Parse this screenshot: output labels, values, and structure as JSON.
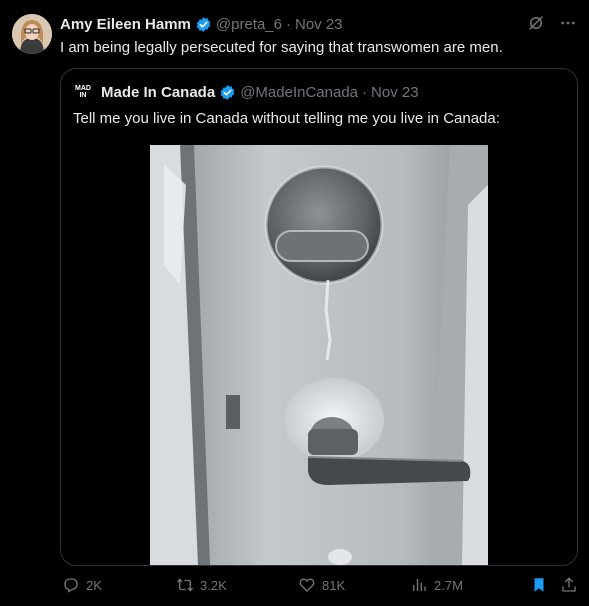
{
  "tweet": {
    "author_name": "Amy Eileen Hamm",
    "author_handle": "@preta_6",
    "separator": "·",
    "date": "Nov 23",
    "text": "I am being legally persecuted for saying that transwomen are men."
  },
  "quote": {
    "logo_text_line1": "MAD",
    "logo_text_line2": "IN",
    "author_name": "Made In Canada",
    "author_handle": "@MadeInCanada",
    "separator": "·",
    "date": "Nov 23",
    "text": "Tell me you live in Canada without telling me you live in Canada:",
    "image_icon": "frozen-door-lock-photo"
  },
  "actions": {
    "replies": "2K",
    "reposts": "3.2K",
    "likes": "81K",
    "views": "2.7M"
  },
  "colors": {
    "background": "#000000",
    "text": "#e7e9ea",
    "muted": "#71767b",
    "border": "#2f3336",
    "verified": "#1d9bf0",
    "bookmark": "#1d9bf0"
  }
}
